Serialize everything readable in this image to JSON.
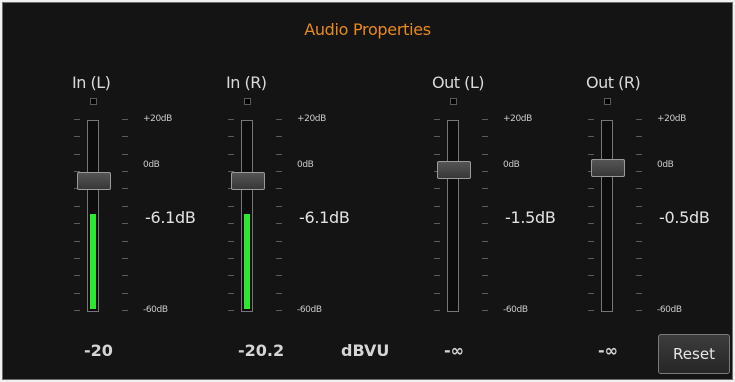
{
  "panel": {
    "title": "Audio Properties",
    "title_color": "#e88a1c",
    "unit_label": "dBVU",
    "reset_label": "Reset",
    "meter_color": "#2ee82e",
    "scale_labels": {
      "top": "+20dB",
      "mid": "0dB",
      "bottom": "-60dB"
    },
    "scale_range_db": [
      -60,
      20
    ]
  },
  "channels": [
    {
      "label": "In (L)",
      "gain": "-6.1dB",
      "level": "-20",
      "gain_db": -6.1,
      "meter_db": -20
    },
    {
      "label": "In (R)",
      "gain": "-6.1dB",
      "level": "-20.2",
      "gain_db": -6.1,
      "meter_db": -20.2
    },
    {
      "label": "Out (L)",
      "gain": "-1.5dB",
      "level": "-∞",
      "gain_db": -1.5,
      "meter_db": null
    },
    {
      "label": "Out (R)",
      "gain": "-0.5dB",
      "level": "-∞",
      "gain_db": -0.5,
      "meter_db": null
    }
  ]
}
